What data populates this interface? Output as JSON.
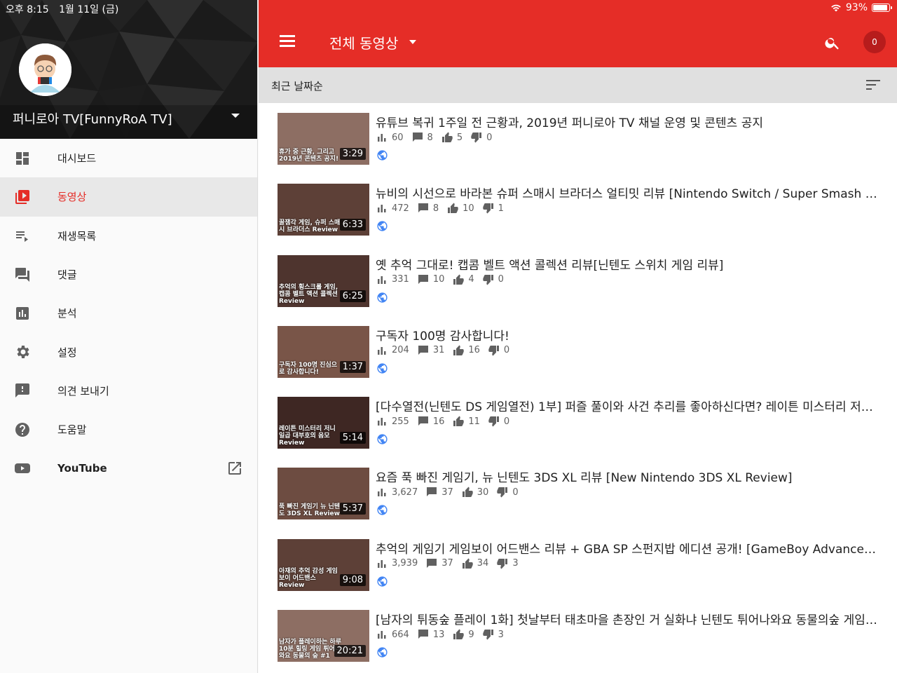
{
  "status": {
    "time": "오후 8:15",
    "date": "1월 11일 (금)",
    "battery": "93%",
    "battery_level": 0.93
  },
  "channel": {
    "name": "퍼니로아 TV[FunnyRoA TV]"
  },
  "sidebar": {
    "items": [
      {
        "label": "대시보드",
        "icon": "dashboard-icon"
      },
      {
        "label": "동영상",
        "icon": "videos-icon",
        "active": true
      },
      {
        "label": "재생목록",
        "icon": "playlist-icon"
      },
      {
        "label": "댓글",
        "icon": "comments-icon"
      },
      {
        "label": "분석",
        "icon": "analytics-icon"
      },
      {
        "label": "설정",
        "icon": "gear-icon"
      },
      {
        "label": "의견 보내기",
        "icon": "feedback-icon"
      },
      {
        "label": "도움말",
        "icon": "help-icon"
      },
      {
        "label": "YouTube",
        "icon": "youtube-icon"
      }
    ]
  },
  "header": {
    "title": "전체 동영상",
    "notifications": "0"
  },
  "sort": {
    "label": "최근 날짜순"
  },
  "colors": {
    "brand": "#e52d27",
    "badge": "#b71c1c"
  },
  "videos": [
    {
      "title": "유튜브 복귀 1주일 전 근황과, 2019년 퍼니로아 TV 채널 운영 및 콘텐츠 공지",
      "duration": "3:29",
      "views": "60",
      "comments": "8",
      "likes": "5",
      "dislikes": "0",
      "thumb_text": "휴가 중 근황, 그리고 2019년 콘텐츠 공지!",
      "thumb_color": "#8d6e63"
    },
    {
      "title": "뉴비의 시선으로 바라본 슈퍼 스매시 브라더스 얼티밋 리뷰 [Nintendo Switch / Super Smash Bros. Ultimate Review]",
      "duration": "6:33",
      "views": "472",
      "comments": "8",
      "likes": "10",
      "dislikes": "1",
      "thumb_text": "꿀잼각 게임, 슈퍼 스매시 브라더스 Review",
      "thumb_color": "#5d4037"
    },
    {
      "title": "옛 추억 그대로! 캡콤 벨트 액션 콜렉션 리뷰[닌텐도 스위치 게임 리뷰]",
      "duration": "6:25",
      "views": "331",
      "comments": "10",
      "likes": "4",
      "dislikes": "0",
      "thumb_text": "추억의 횡스크롤 게임, 캡콤 벨트 액션 콜렉션 Review",
      "thumb_color": "#4e342e"
    },
    {
      "title": "구독자 100명 감사합니다!",
      "duration": "1:37",
      "views": "204",
      "comments": "31",
      "likes": "16",
      "dislikes": "0",
      "thumb_text": "구독자 100명 진심으로 감사합니다!",
      "thumb_color": "#795548"
    },
    {
      "title": "[다수열전(닌텐도 DS 게임열전) 1부] 퍼즐 풀이와 사건 추리를 좋아하신다면? 레이튼 미스터리 저니: 카트리에와 대부호의 음모",
      "duration": "5:14",
      "views": "255",
      "comments": "16",
      "likes": "11",
      "dislikes": "0",
      "thumb_text": "레이튼 미스터리 저니 일곱 대부호의 음모 Review",
      "thumb_color": "#3e2723"
    },
    {
      "title": "요즘 푹 빠진 게임기, 뉴 닌텐도 3DS XL 리뷰 [New Nintendo 3DS XL Review]",
      "duration": "5:37",
      "views": "3,627",
      "comments": "37",
      "likes": "30",
      "dislikes": "0",
      "thumb_text": "푹 빠진 게임기 뉴 닌텐도 3DS XL Review",
      "thumb_color": "#6d4c41"
    },
    {
      "title": "추억의 게임기 게임보이 어드밴스 리뷰 + GBA SP 스펀지밥 에디션 공개! [GameBoy Advance Review]",
      "duration": "9:08",
      "views": "3,939",
      "comments": "37",
      "likes": "34",
      "dislikes": "3",
      "thumb_text": "아재의 추억 감성 게임보이 어드밴스 Review",
      "thumb_color": "#5d4037"
    },
    {
      "title": "[남자의 튀동숲 플레이 1화] 첫날부터 태초마을 촌장인 거 실화냐 닌텐도 튀어나와요 동물의숲 게임 플레이",
      "duration": "20:21",
      "views": "664",
      "comments": "13",
      "likes": "9",
      "dislikes": "3",
      "thumb_text": "남자가 플레이하는 하루 10분 힐링 게임 튀어나와요 동물의 숲 #1",
      "thumb_color": "#8d6e63"
    }
  ]
}
